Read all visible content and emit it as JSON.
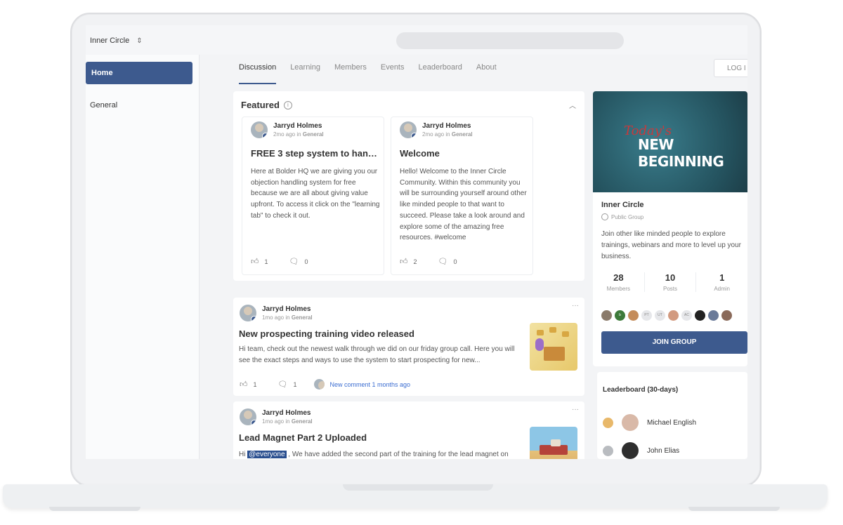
{
  "group_switcher": {
    "name": "Inner Circle"
  },
  "sidebar": {
    "items": [
      {
        "label": "Home"
      },
      {
        "label": "General"
      }
    ]
  },
  "tabs": [
    "Discussion",
    "Learning",
    "Members",
    "Events",
    "Leaderboard",
    "About"
  ],
  "login_label": "LOG I",
  "featured": {
    "title": "Featured",
    "cards": [
      {
        "author": "Jarryd Holmes",
        "time": "2mo ago",
        "in_word": "in",
        "category": "General",
        "title": "FREE 3 step system to handl...",
        "body": "Here at Bolder HQ we are giving you our objection handling system for free because we are all about giving value upfront. To access it click on the \"learning tab\" to check it out.",
        "likes": "1",
        "comments": "0"
      },
      {
        "author": "Jarryd Holmes",
        "time": "2mo ago",
        "in_word": "in",
        "category": "General",
        "title": "Welcome",
        "body": "Hello! Welcome to the Inner Circle Community. Within this community you will be surrounding yourself around other like minded people to that want to succeed. Please take a look around and explore some of the amazing free resources. #welcome",
        "likes": "2",
        "comments": "0"
      }
    ]
  },
  "posts": [
    {
      "author": "Jarryd Holmes",
      "time": "1mo ago",
      "in_word": "in",
      "category": "General",
      "title": "New prospecting training video released",
      "body": "Hi team, check out the newest walk through we did on our friday group call. Here you will see the exact steps and ways to use the system to start prospecting for new...",
      "likes": "1",
      "comments": "1",
      "new_comment": "New comment 1 months ago"
    },
    {
      "author": "Jarryd Holmes",
      "time": "1mo ago",
      "in_word": "in",
      "category": "General",
      "title": "Lead Magnet Part 2 Uploaded",
      "body_prefix": "Hi ",
      "mention": "@everyone",
      "body_suffix": " , We have added the second part of the training for the lead magnet on"
    }
  ],
  "group_card": {
    "banner_script": "Today's",
    "banner_text": "NEW BEGINNING",
    "name": "Inner Circle",
    "type": "Public Group",
    "description": "Join other like minded people to explore trainings, webinars and more to level up your business.",
    "stats": [
      {
        "num": "28",
        "label": "Members"
      },
      {
        "num": "10",
        "label": "Posts"
      },
      {
        "num": "1",
        "label": "Admin"
      }
    ],
    "avatar_initials": [
      "",
      "b",
      "",
      "PT",
      "UT",
      "",
      "AC",
      "",
      "",
      ""
    ],
    "join_label": "JOIN GROUP"
  },
  "leaderboard": {
    "title": "Leaderboard (30-days)",
    "rows": [
      {
        "name": "Michael English"
      },
      {
        "name": "John Elias"
      }
    ]
  },
  "colors": {
    "accent": "#3d5a8e",
    "link": "#3b6dd1",
    "medal_gold": "#e8b86a",
    "medal_silver": "#b9bcc0"
  }
}
